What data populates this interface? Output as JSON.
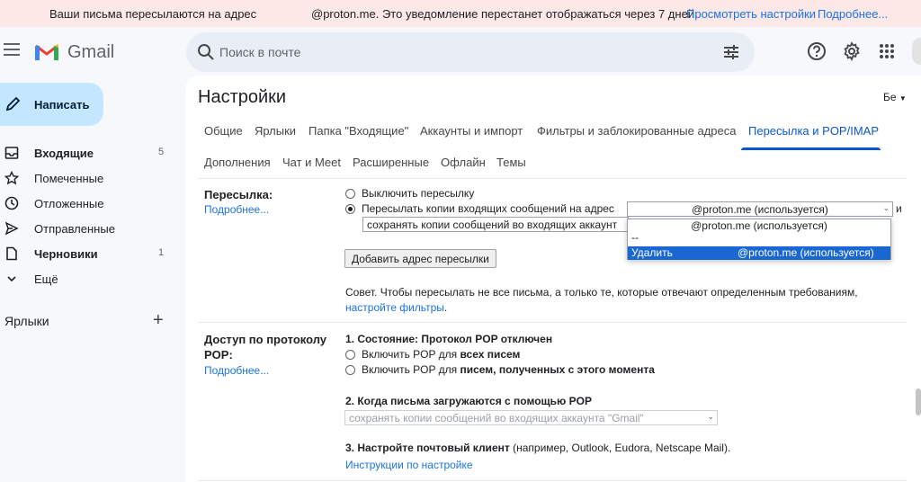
{
  "banner": {
    "part1": "Ваши письма пересылаются на адрес",
    "part2": "@proton.me. Это уведомление перестанет отображаться через 7 дней.",
    "link_settings": "Просмотреть настройки",
    "link_more": "Подробнее..."
  },
  "header": {
    "logo_text": "Gmail",
    "search_placeholder": "Поиск в почте"
  },
  "sidebar": {
    "compose": "Написать",
    "items": [
      {
        "label": "Входящие",
        "count": "5"
      },
      {
        "label": "Помеченные",
        "count": ""
      },
      {
        "label": "Отложенные",
        "count": ""
      },
      {
        "label": "Отправленные",
        "count": ""
      },
      {
        "label": "Черновики",
        "count": "1"
      },
      {
        "label": "Ещё",
        "count": ""
      }
    ],
    "labels_header": "Ярлыки",
    "labels_add": "+"
  },
  "settings": {
    "title": "Настройки",
    "lang": "Бе",
    "tabs_row1": [
      "Общие",
      "Ярлыки",
      "Папка \"Входящие\"",
      "Аккаунты и импорт",
      "Фильтры и заблокированные адреса",
      "Пересылка и POP/IMAP"
    ],
    "tabs_row2": [
      "Дополнения",
      "Чат и Meet",
      "Расширенные",
      "Офлайн",
      "Темы"
    ],
    "active_tab": "Пересылка и POP/IMAP"
  },
  "forwarding": {
    "label": "Пересылка:",
    "more": "Подробнее...",
    "opt_disable": "Выключить пересылку",
    "opt_forward": "Пересылать копии входящих сообщений на адрес",
    "selected_address": "@proton.me (используется)",
    "and": "и",
    "keep_copies": "сохранять копии сообщений во входящих аккаунт",
    "add_button": "Добавить адрес пересылки",
    "tip": "Совет. Чтобы пересылать не все письма, а только те, которые отвечают определенным требованиям,",
    "tip_link": "настройте фильтры",
    "tip_end": ".",
    "dropdown_options": [
      "@proton.me (используется)",
      "--",
      "Удалить"
    ],
    "dropdown_delete_address": "@proton.me (используется)"
  },
  "pop": {
    "label_line1": "Доступ по протоколу",
    "label_line2": "POP:",
    "more": "Подробнее...",
    "status": "1. Состояние: Протокол POP отключен",
    "opt1_prefix": "Включить POP для",
    "opt1_bold": "всех писем",
    "opt2_prefix": "Включить POP для",
    "opt2_bold": "писем, полученных с этого момента",
    "when_title": "2. Когда письма загружаются с помощью POP",
    "when_select": "сохранять копии сообщений во входящих аккаунта \"Gmail\"",
    "client_title": "3. Настройте почтовый клиент",
    "client_rest": "(например, Outlook, Eudora, Netscape Mail).",
    "instructions": "Инструкции по настройке"
  }
}
